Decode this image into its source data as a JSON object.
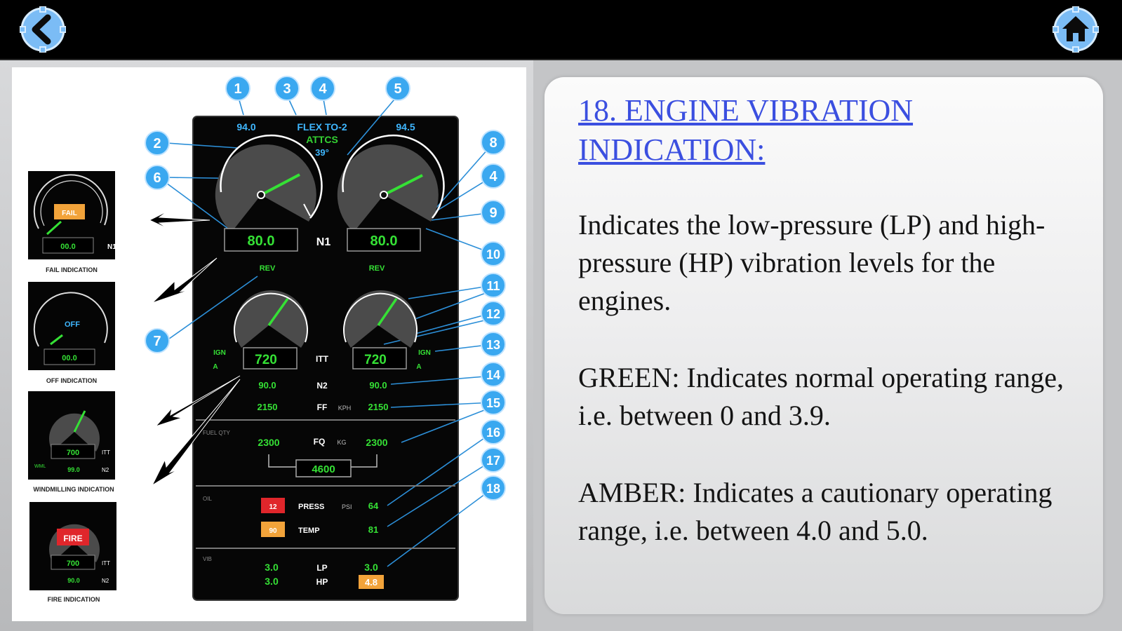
{
  "nav": {
    "back_icon": "back-arrow-icon",
    "home_icon": "home-icon",
    "accent": "#6fb6ff"
  },
  "content": {
    "title": "18. ENGINE VIBRATION INDICATION:",
    "paragraphs": [
      "Indicates the low-pressure (LP) and high-pressure (HP) vibration levels for the engines.",
      "GREEN: Indicates normal operating range, i.e. between 0 and 3.9.",
      "AMBER: Indicates a cautionary operating range, i.e. between 4.0 and 5.0."
    ],
    "title_color": "#3b4fe0"
  },
  "diagram": {
    "callouts": [
      "1",
      "2",
      "3",
      "4",
      "5",
      "6",
      "7",
      "8",
      "4",
      "9",
      "10",
      "11",
      "12",
      "13",
      "14",
      "15",
      "16",
      "17",
      "18"
    ],
    "top": {
      "left_n1_target": "94.0",
      "thrust_mode": "FLEX TO-2",
      "atts": "ATTCS",
      "temp": "39°",
      "right_n1_target": "94.5"
    },
    "n1": {
      "left_value": "80.0",
      "right_value": "80.0",
      "label": "N1",
      "rev_left": "REV",
      "rev_right": "REV"
    },
    "itt": {
      "left_value": "720",
      "right_value": "720",
      "label": "ITT",
      "ign_left": "IGN",
      "ign_left_sub": "A",
      "ign_right": "IGN",
      "ign_right_sub": "A"
    },
    "n2": {
      "left": "90.0",
      "right": "90.0",
      "label": "N2"
    },
    "ff": {
      "left": "2150",
      "right": "2150",
      "label": "FF",
      "unit": "KPH"
    },
    "fuel": {
      "section": "FUEL QTY",
      "left": "2300",
      "right": "2300",
      "label": "FQ",
      "unit": "KG",
      "total": "4600"
    },
    "oil": {
      "section": "OIL",
      "press_label": "PRESS",
      "press_unit": "PSI",
      "press_value": "64",
      "temp_label": "TEMP",
      "temp_value": "81",
      "press_flag": "12",
      "temp_flag": "90"
    },
    "vib": {
      "section": "VIB",
      "lp_left": "3.0",
      "hp_left": "3.0",
      "lp_label": "LP",
      "hp_label": "HP",
      "lp_right": "3.0",
      "hp_right": "4.8"
    },
    "thumbs": [
      {
        "caption": "FAIL INDICATION",
        "badge": "FAIL",
        "value": "00.0",
        "side": "N1"
      },
      {
        "caption": "OFF INDICATION",
        "badge": "OFF",
        "value": "00.0"
      },
      {
        "caption": "WINDMILLING INDICATION",
        "value": "700",
        "side_top": "ITT",
        "low": "99.0",
        "side_bottom": "N2",
        "left_small": "WML"
      },
      {
        "caption": "FIRE INDICATION",
        "badge": "FIRE",
        "value": "700",
        "side_top": "ITT",
        "low": "90.0",
        "side_bottom": "N2"
      }
    ]
  }
}
